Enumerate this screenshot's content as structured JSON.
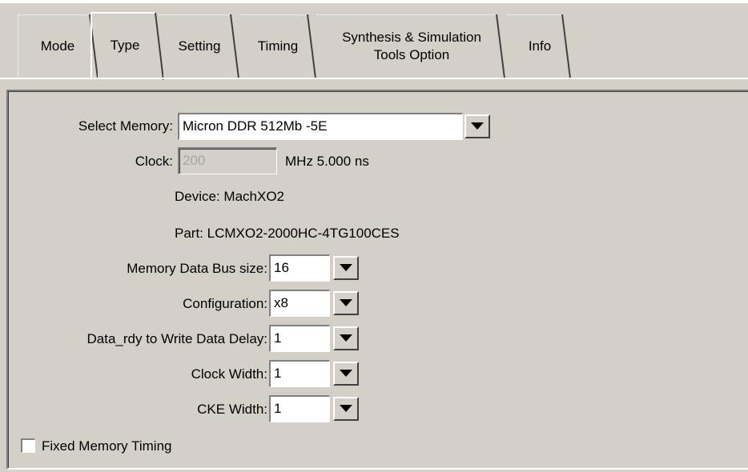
{
  "tabs": [
    {
      "label": "Mode"
    },
    {
      "label": "Type",
      "selected": true
    },
    {
      "label": "Setting"
    },
    {
      "label": "Timing"
    },
    {
      "label": "Synthesis & Simulation",
      "label2": "Tools Option"
    },
    {
      "label": "Info"
    }
  ],
  "form": {
    "select_memory_label": "Select Memory:",
    "select_memory_value": "Micron DDR 512Mb -5E",
    "clock_label": "Clock:",
    "clock_value": "200",
    "clock_unit": "MHz 5.000 ns",
    "device_text": "Device: MachXO2",
    "part_text": "Part: LCMXO2-2000HC-4TG100CES",
    "bus_size_label": "Memory Data Bus size:",
    "bus_size_value": "16",
    "config_label": "Configuration:",
    "config_value": "x8",
    "data_rdy_label": "Data_rdy to Write Data Delay:",
    "data_rdy_value": "1",
    "clock_width_label": "Clock Width:",
    "clock_width_value": "1",
    "cke_width_label": "CKE Width:",
    "cke_width_value": "1",
    "fixed_timing_label": "Fixed Memory Timing",
    "fixed_timing_checked": false
  },
  "icons": {
    "dropdown": "triangle-down-icon"
  },
  "colors": {
    "face": "#d4d0c8",
    "field_bg": "#ffffff",
    "disabled_text": "#a6a6a6"
  }
}
